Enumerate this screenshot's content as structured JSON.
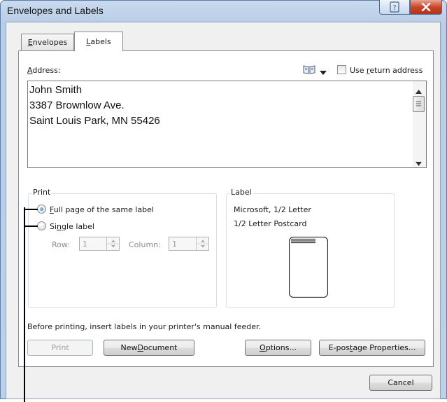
{
  "window": {
    "title": "Envelopes and Labels"
  },
  "tabs": [
    {
      "label": "Envelopes",
      "mnemonic": "E",
      "rest": "nvelopes"
    },
    {
      "label": "Labels",
      "mnemonic": "L",
      "rest": "abels"
    }
  ],
  "address": {
    "label": "Address:",
    "label_mnemonic": "A",
    "label_rest": "ddress:",
    "lines": [
      "John Smith",
      "3387 Brownlow Ave.",
      "Saint Louis Park, MN 55426"
    ],
    "use_return_address": {
      "pre": "Use ",
      "mnemonic": "r",
      "rest": "eturn address",
      "checked": false
    }
  },
  "print_group": {
    "legend": "Print",
    "full_page": {
      "mnemonic": "F",
      "rest": "ull page of the same label",
      "selected": true
    },
    "single": {
      "pre": "Si",
      "mnemonic": "n",
      "rest": "gle label",
      "selected": false
    },
    "row_label": "Row:",
    "row_value": "1",
    "column_label": "Column:",
    "column_value": "1"
  },
  "label_group": {
    "legend": "Label",
    "vendor": "Microsoft, 1/2 Letter",
    "product": "1/2 Letter Postcard"
  },
  "note": "Before printing, insert labels in your printer's manual feeder.",
  "buttons": {
    "print": "Print",
    "new_document": {
      "pre": "New ",
      "mnemonic": "D",
      "rest": "ocument"
    },
    "options": {
      "mnemonic": "O",
      "rest": "ptions..."
    },
    "epostage": {
      "pre": "E-pos",
      "mnemonic": "t",
      "rest": "age Properties..."
    },
    "cancel": "Cancel"
  },
  "colors": {
    "accent": "#1b6fd2",
    "close": "#c7472b",
    "frame": "#b9cde6"
  }
}
